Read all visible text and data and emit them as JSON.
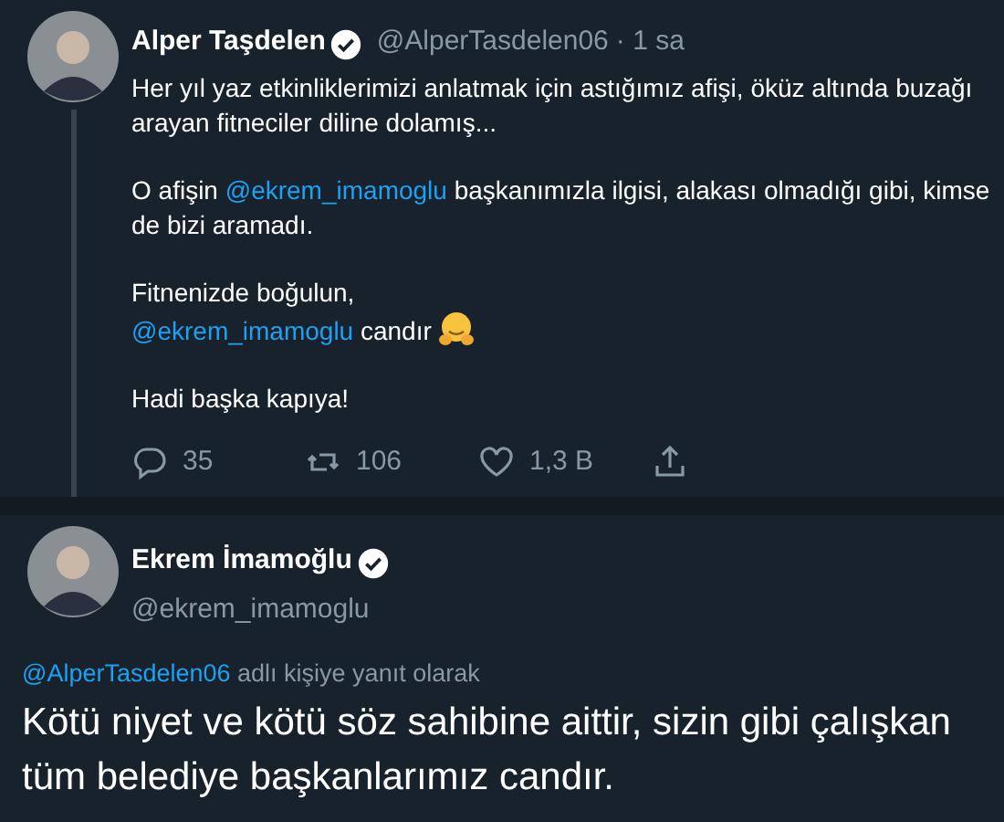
{
  "tweets": [
    {
      "name": "Alper Taşdelen",
      "verified": true,
      "handle": "@AlperTasdelen06",
      "time": "· 1 sa",
      "thread_line": true,
      "paragraphs": [
        [
          {
            "kind": "text",
            "text": "Her yıl yaz etkinliklerimizi anlatmak için astığımız afişi, öküz altında buzağı"
          },
          {
            "kind": "break"
          },
          {
            "kind": "text",
            "text": "arayan fitneciler diline dolamış..."
          }
        ],
        [
          {
            "kind": "text",
            "text": "O afişin "
          },
          {
            "kind": "mention",
            "text": "@ekrem_imamoglu"
          },
          {
            "kind": "text",
            "text": " başkanımızla ilgisi, alakası olmadığı gibi, kimse"
          },
          {
            "kind": "break"
          },
          {
            "kind": "text",
            "text": "de bizi aramadı."
          }
        ],
        [
          {
            "kind": "text",
            "text": "Fitnenizde boğulun,"
          },
          {
            "kind": "break"
          },
          {
            "kind": "mention",
            "text": "@ekrem_imamoglu"
          },
          {
            "kind": "text",
            "text": " candır "
          },
          {
            "kind": "emoji"
          }
        ],
        [
          {
            "kind": "text",
            "text": "Hadi başka kapıya!"
          }
        ]
      ],
      "actions": [
        {
          "kind": "reply",
          "count": "35"
        },
        {
          "kind": "retweet",
          "count": "106"
        },
        {
          "kind": "like",
          "count": "1,3 B"
        },
        {
          "kind": "share"
        }
      ]
    },
    {
      "name": "Ekrem İmamoğlu",
      "verified": true,
      "handle": "@ekrem_imamoglu",
      "reply_to": {
        "mention": "@AlperTasdelen06",
        "text": "adlı kişiye yanıt olarak"
      },
      "body": [
        {
          "kind": "text",
          "text": "Kötü niyet ve kötü söz sahibine aittir, sizin gibi çalışkan"
        },
        {
          "kind": "break"
        },
        {
          "kind": "text",
          "text": "tüm belediye başkanlarımız candır."
        }
      ]
    }
  ]
}
